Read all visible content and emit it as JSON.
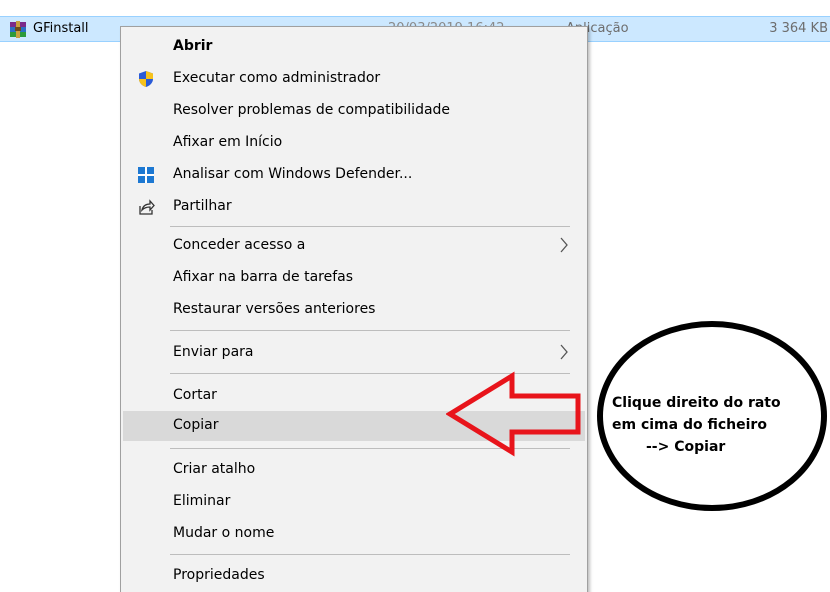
{
  "file": {
    "name": "GFinstall",
    "date": "20/03/2019 16:42",
    "type": "Aplicação",
    "size": "3 364 KB"
  },
  "menu": {
    "items": [
      {
        "label": "Abrir"
      },
      {
        "label": "Executar como administrador",
        "icon": "shield-icon"
      },
      {
        "label": "Resolver problemas de compatibilidade"
      },
      {
        "label": "Afixar em Início"
      },
      {
        "label": "Analisar com Windows Defender...",
        "icon": "windows-defender-icon"
      },
      {
        "label": "Partilhar",
        "icon": "share-icon"
      },
      {
        "label": "Conceder acesso a",
        "submenu": true
      },
      {
        "label": "Afixar na barra de tarefas"
      },
      {
        "label": "Restaurar versões anteriores"
      },
      {
        "label": "Enviar para",
        "submenu": true
      },
      {
        "label": "Cortar"
      },
      {
        "label": "Copiar",
        "highlighted": true
      },
      {
        "label": "Criar atalho"
      },
      {
        "label": "Eliminar"
      },
      {
        "label": "Mudar o nome"
      },
      {
        "label": "Propriedades"
      }
    ]
  },
  "annotation": {
    "line1": "Clique direito do rato",
    "line2": "em cima do ficheiro",
    "line3": "--> Copiar",
    "arrow_color": "#e8141b",
    "ellipse_color": "#000000"
  },
  "colors": {
    "selection_row": "#cce8ff",
    "menu_background": "#f2f2f2",
    "menu_highlight": "#d9d9d9"
  }
}
